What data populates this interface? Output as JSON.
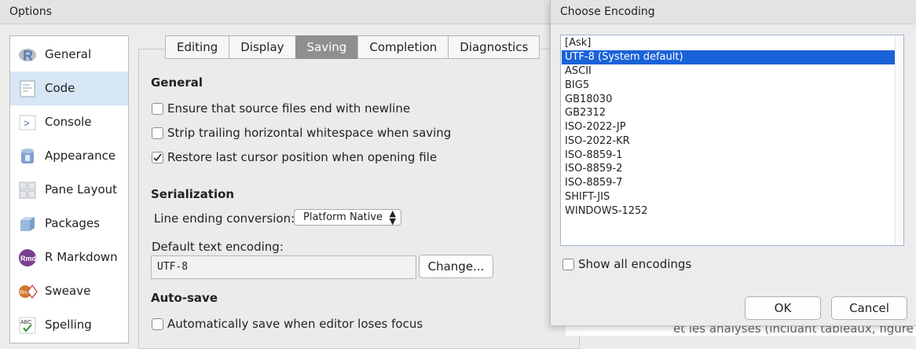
{
  "options_window": {
    "title": "Options"
  },
  "sidebar": {
    "items": [
      {
        "label": "General",
        "icon": "r-logo-icon",
        "active": false
      },
      {
        "label": "Code",
        "icon": "code-file-icon",
        "active": true
      },
      {
        "label": "Console",
        "icon": "console-prompt-icon",
        "active": false
      },
      {
        "label": "Appearance",
        "icon": "paint-bucket-icon",
        "active": false
      },
      {
        "label": "Pane Layout",
        "icon": "pane-layout-icon",
        "active": false
      },
      {
        "label": "Packages",
        "icon": "package-box-icon",
        "active": false
      },
      {
        "label": "R Markdown",
        "icon": "rmd-icon",
        "active": false
      },
      {
        "label": "Sweave",
        "icon": "sweave-icon",
        "active": false
      },
      {
        "label": "Spelling",
        "icon": "spelling-check-icon",
        "active": false
      }
    ]
  },
  "tabs": [
    {
      "label": "Editing",
      "active": false
    },
    {
      "label": "Display",
      "active": false
    },
    {
      "label": "Saving",
      "active": true
    },
    {
      "label": "Completion",
      "active": false
    },
    {
      "label": "Diagnostics",
      "active": false
    }
  ],
  "saving": {
    "general_title": "General",
    "general_options": [
      {
        "label": "Ensure that source files end with newline",
        "checked": false
      },
      {
        "label": "Strip trailing horizontal whitespace when saving",
        "checked": false
      },
      {
        "label": "Restore last cursor position when opening file",
        "checked": true
      }
    ],
    "serialization_title": "Serialization",
    "line_ending_label": "Line ending conversion:",
    "line_ending_value": "Platform Native",
    "encoding_label": "Default text encoding:",
    "encoding_value": "UTF-8",
    "change_button": "Change...",
    "autosave_title": "Auto-save",
    "autosave_options": [
      {
        "label": "Automatically save when editor loses focus",
        "checked": false
      }
    ]
  },
  "encoding_dialog": {
    "title": "Choose Encoding",
    "encodings": [
      "[Ask]",
      "UTF-8 (System default)",
      "ASCII",
      "BIG5",
      "GB18030",
      "GB2312",
      "ISO-2022-JP",
      "ISO-2022-KR",
      "ISO-8859-1",
      "ISO-8859-2",
      "ISO-8859-7",
      "SHIFT-JIS",
      "WINDOWS-1252"
    ],
    "selected_index": 1,
    "show_all_label": "Show all encodings",
    "show_all_checked": false,
    "ok_button": "OK",
    "cancel_button": "Cancel"
  },
  "background_text": "et les analyses (incluant tableaux, figure",
  "colors": {
    "selection": "#1a62d8",
    "sidebar_active": "#d6e6f5",
    "active_tab": "#8f8f8f"
  }
}
